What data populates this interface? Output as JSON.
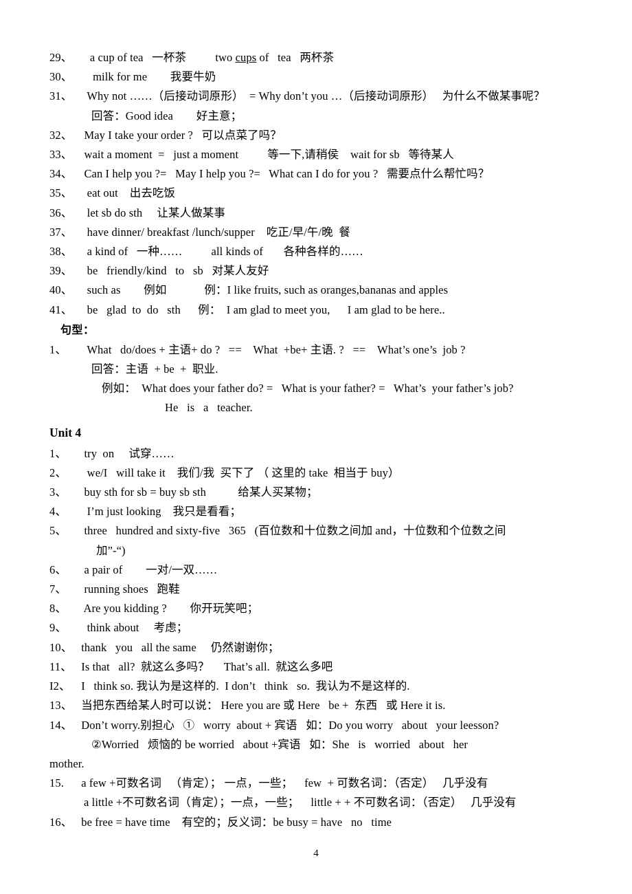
{
  "document": {
    "page_number": "4",
    "section_heading_sentence_patterns": "句型：",
    "unit_heading": "Unit 4"
  },
  "entries_unit3": [
    {
      "num": "29、",
      "text": "    a cup of tea   一杯茶          two ",
      "underlined": "cups",
      "text_after": " of   tea   两杯茶"
    },
    {
      "num": "30、",
      "text": "     milk for me        我要牛奶"
    },
    {
      "num": "31、",
      "text": "   Why not ……（后接动词原形）  = Why don’t you …（后接动词原形）   为什么不做某事呢？"
    },
    {
      "num": "",
      "text": "回答：Good idea        好主意；",
      "indent": true
    },
    {
      "num": "32、",
      "text": "  May I take your order ?   可以点菜了吗？"
    },
    {
      "num": "33、",
      "text": "  wait a moment  =   just a moment          等一下,请稍侯    wait for sb   等待某人"
    },
    {
      "num": "34、",
      "text": "  Can I help you ?=   May I help you ?=   What can I do for you ?   需要点什么帮忙吗？"
    },
    {
      "num": "35、",
      "text": "   eat out    出去吃饭"
    },
    {
      "num": "36、",
      "text": "   let sb do sth     让某人做某事"
    },
    {
      "num": "37、",
      "text": "   have dinner/ breakfast /lunch/supper    吃正/早/午/晚  餐"
    },
    {
      "num": "38、",
      "text": "   a kind of   一种……          all kinds of       各种各样的……"
    },
    {
      "num": "39、",
      "text": "   be   friendly/kind   to   sb   对某人友好"
    },
    {
      "num": "40、",
      "text": "   such as        例如             例：I like fruits, such as oranges,bananas and apples"
    },
    {
      "num": "41、",
      "text": "   be   glad  to  do   sth      例：  I am glad to meet you,      I am glad to be here.."
    }
  ],
  "sentence_patterns": [
    {
      "num": "1、",
      "text": "   What   do/does + 主语+ do ?   ==    What  +be+ 主语. ?   ==    What’s one’s  job ?"
    },
    {
      "num": "",
      "text": "回答：主语  + be  +  职业.",
      "indent": true
    },
    {
      "num": "",
      "text": "例如：  What does your father do? =   What is your father? =   What’s  your father’s job?",
      "indent2": true
    },
    {
      "num": "",
      "text": "He   is   a   teacher.",
      "indent3": true
    }
  ],
  "entries_unit4": [
    {
      "num": "1、",
      "text": "  try  on     试穿……"
    },
    {
      "num": "2、",
      "text": "   we/I   will take it    我们/我  买下了 （ 这里的 take  相当于 buy）"
    },
    {
      "num": "3、",
      "text": "  buy sth for sb = buy sb sth           给某人买某物；"
    },
    {
      "num": "4、",
      "text": "   I’m just looking    我只是看看；"
    },
    {
      "num": "5、",
      "text": "  three   hundred and sixty-five   365   (百位数和十位数之间加 and，十位数和个位数之间"
    },
    {
      "num": "",
      "text": "加”-“)",
      "indentc": true
    },
    {
      "num": "6、",
      "text": "  a pair of        一对/一双……"
    },
    {
      "num": "7、",
      "text": "  running shoes   跑鞋"
    },
    {
      "num": "8、",
      "text": "  Are you kidding ?        你开玩笑吧；"
    },
    {
      "num": "9、",
      "text": "   think about     考虑；"
    },
    {
      "num": "10、",
      "text": " thank   you   all the same     仍然谢谢你；"
    },
    {
      "num": "11、",
      "text": " Is that   all?  就这么多吗？     That’s all.  就这么多吧"
    },
    {
      "num": "I2、",
      "text": " I   think so. 我认为是这样的.  I don’t   think   so.  我认为不是这样的."
    },
    {
      "num": "13、",
      "text": " 当把东西给某人时可以说： Here you are 或 Here   be +  东西   或 Here it is."
    },
    {
      "num": "14、",
      "text": " Don’t worry.别担心   ①   worry  about + 宾语   如：Do you worry   about   your leesson?"
    },
    {
      "num": "",
      "text": "②Worried   烦恼的 be worried   about +宾语   如：She   is   worried   about   her",
      "indent": true
    },
    {
      "num": "",
      "text": "mother.",
      "indent0": true
    },
    {
      "num": "15.",
      "text": " a few +可数名词   （肯定）； 一点，一些；    few  + 可数名词：（否定）   几乎没有"
    },
    {
      "num": "",
      "text": "a little +不可数名词（肯定）；一点，一些；    little + + 不可数名词：（否定）   几乎没有",
      "indentb": true
    },
    {
      "num": "16、",
      "text": " be free = have time    有空的；反义词：be busy = have   no   time"
    }
  ]
}
